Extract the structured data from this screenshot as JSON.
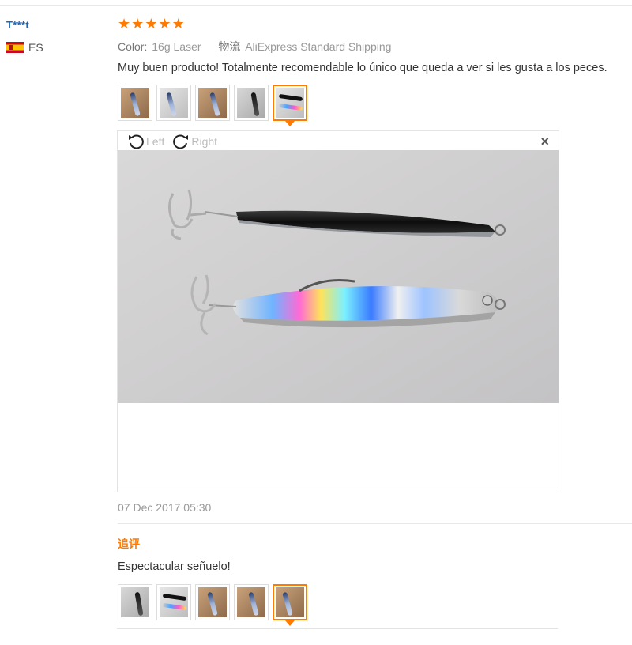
{
  "user": {
    "name": "T***t",
    "country_code": "ES"
  },
  "review": {
    "rating": 5,
    "color_label": "Color:",
    "color_value": "16g Laser",
    "shipping_label": "物流",
    "shipping_value": "AliExpress Standard Shipping",
    "text": "Muy buen producto! Totalmente recomendable lo único que queda a ver si les gusta a los peces.",
    "thumbnails_count": 5,
    "active_thumbnail": 5,
    "viewer": {
      "rotate_left_label": "Left",
      "rotate_right_label": "Right",
      "close_label": "×"
    },
    "date": "07 Dec 2017 05:30"
  },
  "followup": {
    "label": "追评",
    "text": "Espectacular señuelo!",
    "thumbnails_count": 5,
    "active_thumbnail": 5
  },
  "colors": {
    "accent": "#ff7a00",
    "username": "#1c64b4"
  }
}
